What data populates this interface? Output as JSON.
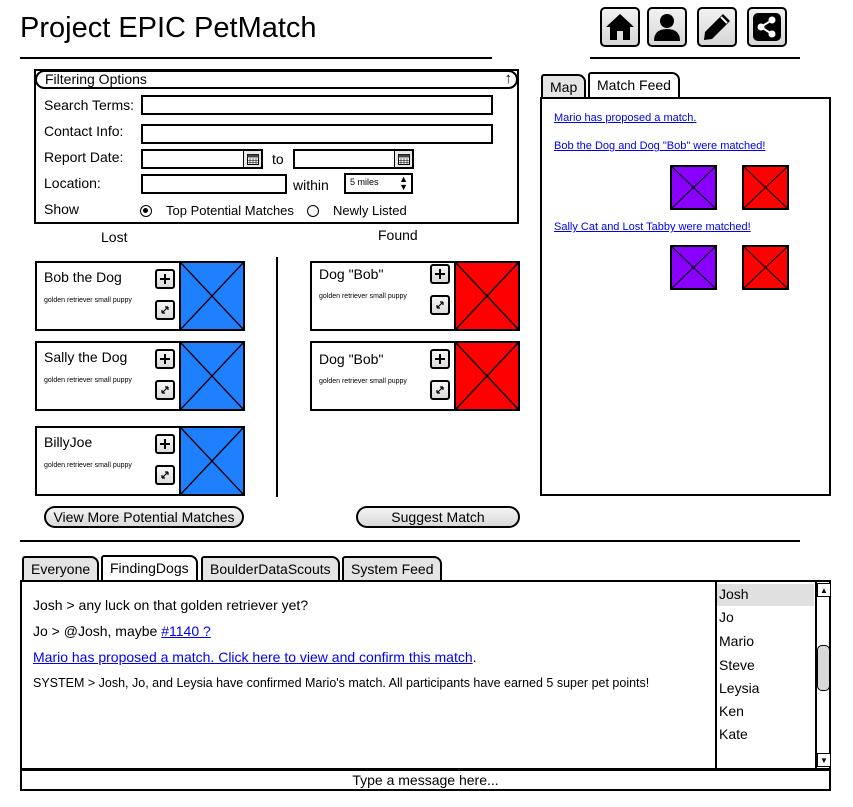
{
  "app": {
    "title": "Project EPIC PetMatch"
  },
  "header_icons": [
    "home-icon",
    "user-icon",
    "pencil-icon",
    "share-icon"
  ],
  "filter": {
    "header": "Filtering Options",
    "search_label": "Search Terms:",
    "contact_label": "Contact Info:",
    "report_date_label": "Report Date:",
    "to_label": "to",
    "location_label": "Location:",
    "within_label": "within",
    "distance": "5 miles",
    "show_label": "Show",
    "option_top": "Top Potential Matches",
    "option_new": "Newly Listed"
  },
  "columns": {
    "lost": "Lost",
    "found": "Found"
  },
  "lost_pets": [
    {
      "name": "Bob the Dog",
      "desc": "golden retriever small puppy"
    },
    {
      "name": "Sally the Dog",
      "desc": "golden retriever small puppy"
    },
    {
      "name": "BillyJoe",
      "desc": "golden retriever small puppy"
    }
  ],
  "found_pets": [
    {
      "name": "Dog \"Bob\"",
      "desc": "golden retriever small puppy"
    },
    {
      "name": "Dog \"Bob\"",
      "desc": "golden retriever small puppy"
    }
  ],
  "buttons": {
    "view_more": "View More Potential Matches",
    "suggest": "Suggest Match"
  },
  "right_tabs": [
    "Map",
    "Match Feed"
  ],
  "match_feed": [
    "Mario has proposed a match. ",
    "Bob the Dog and Dog \"Bob\" were matched!",
    "Sally Cat and Lost Tabby were matched!"
  ],
  "chat_tabs": [
    "Everyone",
    "FindingDogs",
    "BoulderDataScouts",
    "System Feed"
  ],
  "chat": {
    "line1": "Josh > any luck on that golden retriever yet?",
    "line2_prefix": "Jo > @Josh, maybe ",
    "line2_link": "#1140 ?",
    "line3_link": "Mario has proposed a match.  Click here to view and confirm this match",
    "line3_suffix": ".",
    "line4": "SYSTEM > Josh, Jo, and Leysia have confirmed Mario's match.  All participants have earned 5 super pet points!",
    "input_placeholder": "Type a message here..."
  },
  "users": [
    "Josh",
    "Jo",
    "Mario",
    "Steve",
    "Leysia",
    "Ken",
    "Kate"
  ],
  "colors": {
    "lost_photo": "#1e7fff",
    "found_photo": "#ff0000",
    "thumb_purple": "#8a00ff"
  }
}
